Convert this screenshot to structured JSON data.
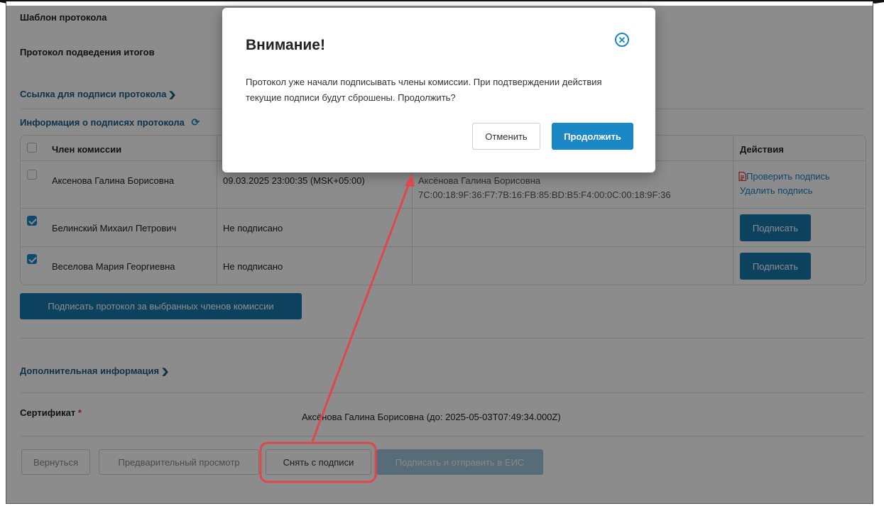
{
  "page": {
    "template_label": "Шаблон протокола",
    "protocol_name": "Протокол подведения итогов",
    "sign_link_label": "Ссылка для подписи протокола",
    "signatures_info_label": "Информация о подписях протокола",
    "additional_info_label": "Дополнительная информация",
    "certificate_label": "Сертификат",
    "certificate_required_mark": "*",
    "certificate_value": "Аксёнова Галина Борисовна (до: 2025-05-03T07:49:34.000Z)",
    "sign_selected_button": "Подписать протокол за выбранных членов комиссии"
  },
  "table": {
    "headers": {
      "member": "Член комиссии",
      "actions": "Действия"
    },
    "rows": [
      {
        "checked": false,
        "member": "Аксенова Галина Борисовна",
        "date": "09.03.2025 23:00:35 (MSK+05:00)",
        "signer": "Аксёнова Галина Борисовна",
        "thumbprint": "7C:00:18:9F:36:F7:7B:16:FB:85:BD:B5:F4:00:0C:00:18:9F:36",
        "action_check": "Проверить подпись",
        "action_delete": "Удалить подпись"
      },
      {
        "checked": true,
        "member": "Белинский Михаил Петрович",
        "date": "Не подписано",
        "action_sign": "Подписать"
      },
      {
        "checked": true,
        "member": "Веселова Мария Георгиевна",
        "date": "Не подписано",
        "action_sign": "Подписать"
      }
    ]
  },
  "footer_buttons": {
    "back": "Вернуться",
    "preview": "Предварительный просмотр",
    "unsign": "Снять с подписи",
    "sign_send": "Подписать и отправить в ЕИС"
  },
  "modal": {
    "title": "Внимание!",
    "message": "Протокол уже начали подписывать члены комиссии. При подтверждении действия текущие подписи будут сброшены. Продолжить?",
    "cancel": "Отменить",
    "continue": "Продолжить"
  },
  "colors": {
    "primary": "#1878ad",
    "accent": "#1a87c6",
    "link": "#1d5b86",
    "annotation": "#e0474c"
  }
}
